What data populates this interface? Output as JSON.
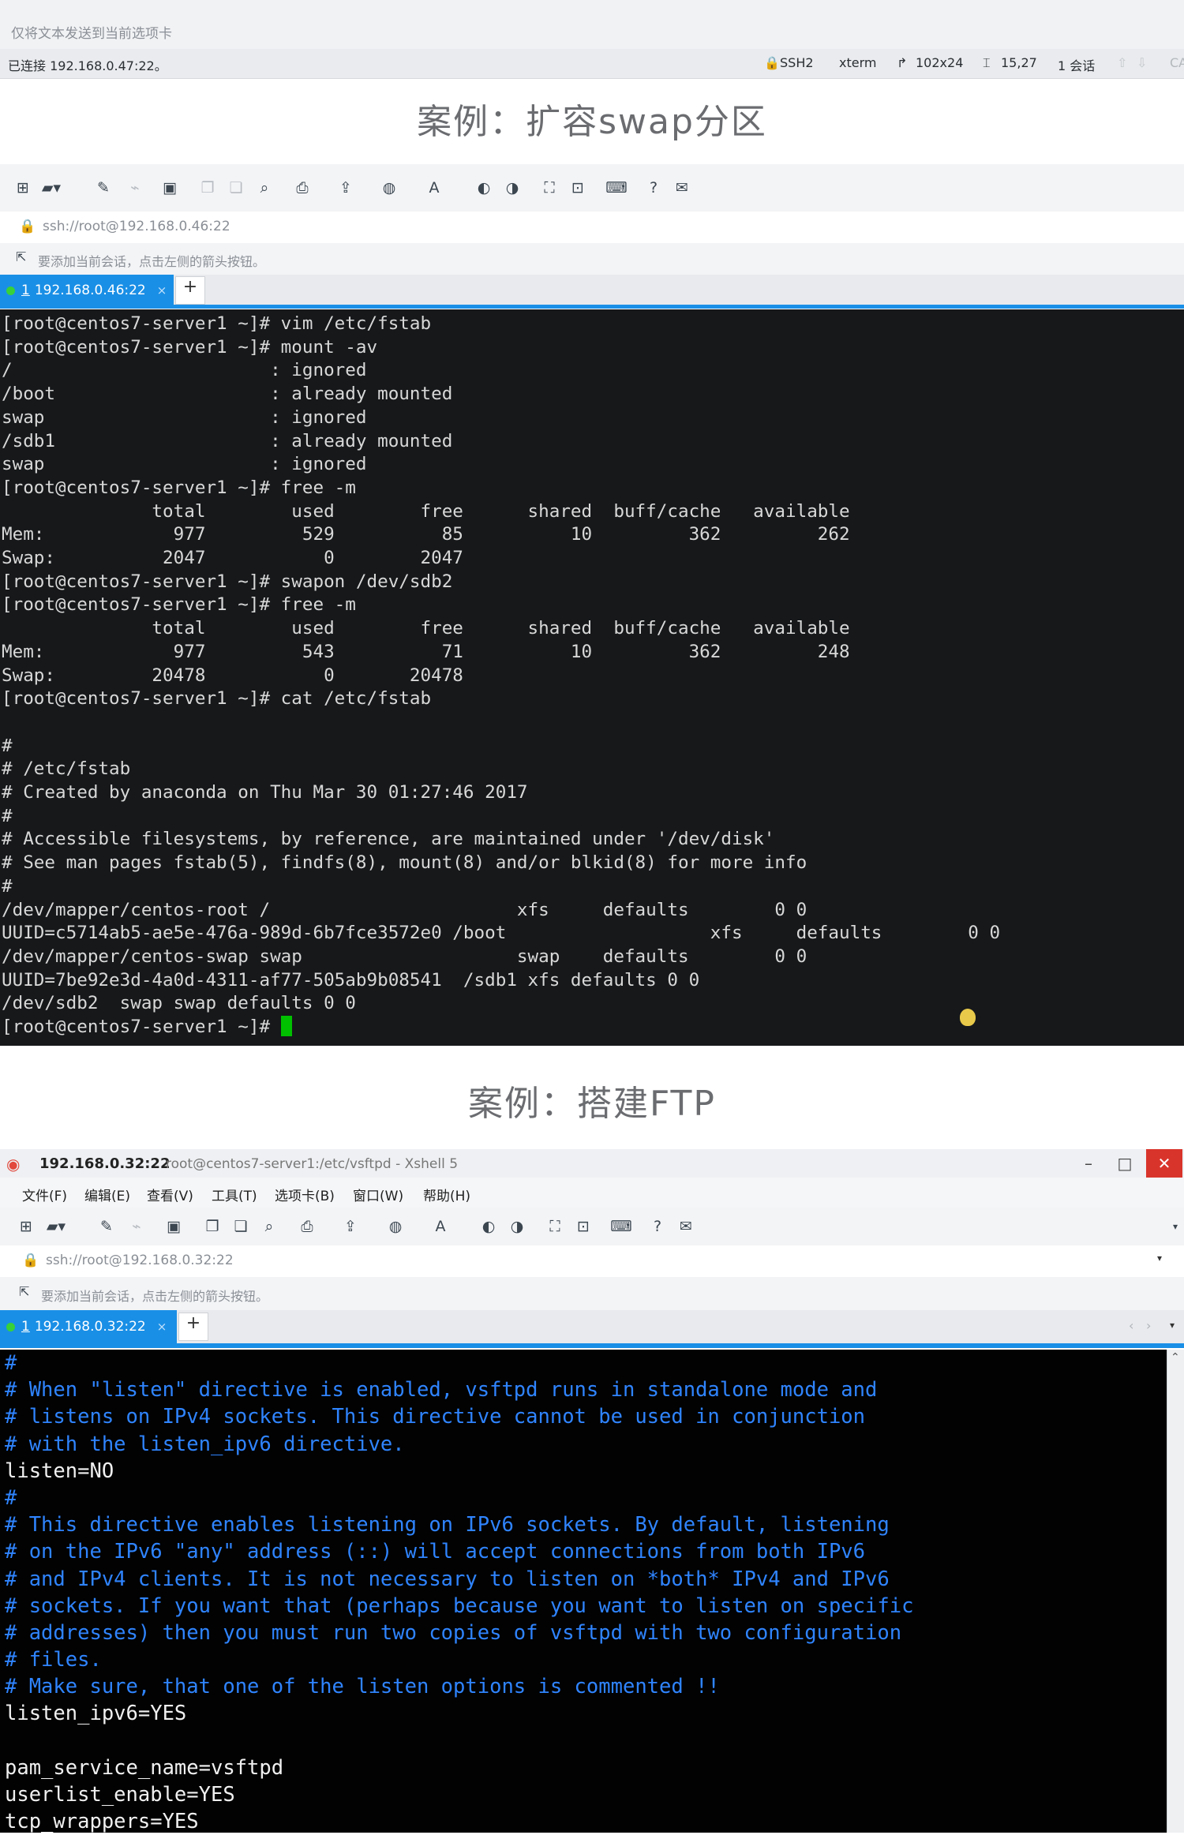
{
  "top_window": {
    "send_bar_text": "仅将文本发送到当前选项卡",
    "status": {
      "connection": "已连接 192.168.0.47:22。",
      "protocol": "SSH2",
      "terminal": "xterm",
      "size": "102x24",
      "cursor_pos": "15,27",
      "sessions": "1 会话",
      "cap": "CA"
    }
  },
  "section1_title": "案例：扩容swap分区",
  "section2_title": "案例：搭建FTP",
  "window1": {
    "address": "ssh://root@192.168.0.46:22",
    "hint": "要添加当前会话，点击左侧的箭头按钮。",
    "tab": {
      "number": "1",
      "label": "192.168.0.46:22"
    },
    "terminal_lines": [
      "[root@centos7-server1 ~]# vim /etc/fstab",
      "[root@centos7-server1 ~]# mount -av",
      "/                        : ignored",
      "/boot                    : already mounted",
      "swap                     : ignored",
      "/sdb1                    : already mounted",
      "swap                     : ignored",
      "[root@centos7-server1 ~]# free -m",
      "              total        used        free      shared  buff/cache   available",
      "Mem:            977         529          85          10         362         262",
      "Swap:          2047           0        2047",
      "[root@centos7-server1 ~]# swapon /dev/sdb2",
      "[root@centos7-server1 ~]# free -m",
      "              total        used        free      shared  buff/cache   available",
      "Mem:            977         543          71          10         362         248",
      "Swap:         20478           0       20478",
      "[root@centos7-server1 ~]# cat /etc/fstab",
      "",
      "#",
      "# /etc/fstab",
      "# Created by anaconda on Thu Mar 30 01:27:46 2017",
      "#",
      "# Accessible filesystems, by reference, are maintained under '/dev/disk'",
      "# See man pages fstab(5), findfs(8), mount(8) and/or blkid(8) for more info",
      "#",
      "/dev/mapper/centos-root /                       xfs     defaults        0 0",
      "UUID=c5714ab5-ae5e-476a-989d-6b7fce3572e0 /boot                   xfs     defaults        0 0",
      "/dev/mapper/centos-swap swap                    swap    defaults        0 0",
      "UUID=7be92e3d-4a0d-4311-af77-505ab9b08541  /sdb1 xfs defaults 0 0",
      "/dev/sdb2  swap swap defaults 0 0"
    ],
    "prompt": "[root@centos7-server1 ~]# "
  },
  "window2": {
    "title_ip": "192.168.0.32:22",
    "title_path": "root@centos7-server1:/etc/vsftpd - Xshell 5",
    "menu": [
      "文件(F)",
      "编辑(E)",
      "查看(V)",
      "工具(T)",
      "选项卡(B)",
      "窗口(W)",
      "帮助(H)"
    ],
    "address": "ssh://root@192.168.0.32:22",
    "hint": "要添加当前会话，点击左侧的箭头按钮。",
    "tab": {
      "number": "1",
      "label": "192.168.0.32:22"
    },
    "lines": [
      {
        "t": "#",
        "c": true
      },
      {
        "t": "# When \"listen\" directive is enabled, vsftpd runs in standalone mode and",
        "c": true
      },
      {
        "t": "# listens on IPv4 sockets. This directive cannot be used in conjunction",
        "c": true
      },
      {
        "t": "# with the listen_ipv6 directive.",
        "c": true
      },
      {
        "t": "listen=NO",
        "c": false
      },
      {
        "t": "#",
        "c": true
      },
      {
        "t": "# This directive enables listening on IPv6 sockets. By default, listening",
        "c": true
      },
      {
        "t": "# on the IPv6 \"any\" address (::) will accept connections from both IPv6",
        "c": true
      },
      {
        "t": "# and IPv4 clients. It is not necessary to listen on *both* IPv4 and IPv6",
        "c": true
      },
      {
        "t": "# sockets. If you want that (perhaps because you want to listen on specific",
        "c": true
      },
      {
        "t": "# addresses) then you must run two copies of vsftpd with two configuration",
        "c": true
      },
      {
        "t": "# files.",
        "c": true
      },
      {
        "t": "# Make sure, that one of the listen options is commented !!",
        "c": true
      },
      {
        "t": "listen_ipv6=YES",
        "c": false
      },
      {
        "t": "",
        "c": false
      },
      {
        "t": "pam_service_name=vsftpd",
        "c": false
      },
      {
        "t": "userlist_enable=YES",
        "c": false
      },
      {
        "t": "tcp_wrappers=YES",
        "c": false
      }
    ]
  },
  "icons": {
    "toolbar": [
      "new-session-icon",
      "open-folder-icon",
      "edit-icon",
      "properties-icon",
      "copy-icon",
      "paste-icon",
      "find-icon",
      "print-icon",
      "transfer-icon",
      "globe-icon",
      "font-icon",
      "xftp-icon",
      "xmanager-icon",
      "fullscreen-icon",
      "lock-icon",
      "keyboard-icon",
      "help-icon",
      "chat-icon"
    ]
  },
  "colors": {
    "accent": "#1a8fe6",
    "comment_blue": "#2f84ff",
    "prompt_cursor": "#00c000",
    "close_red": "#d9342b"
  }
}
